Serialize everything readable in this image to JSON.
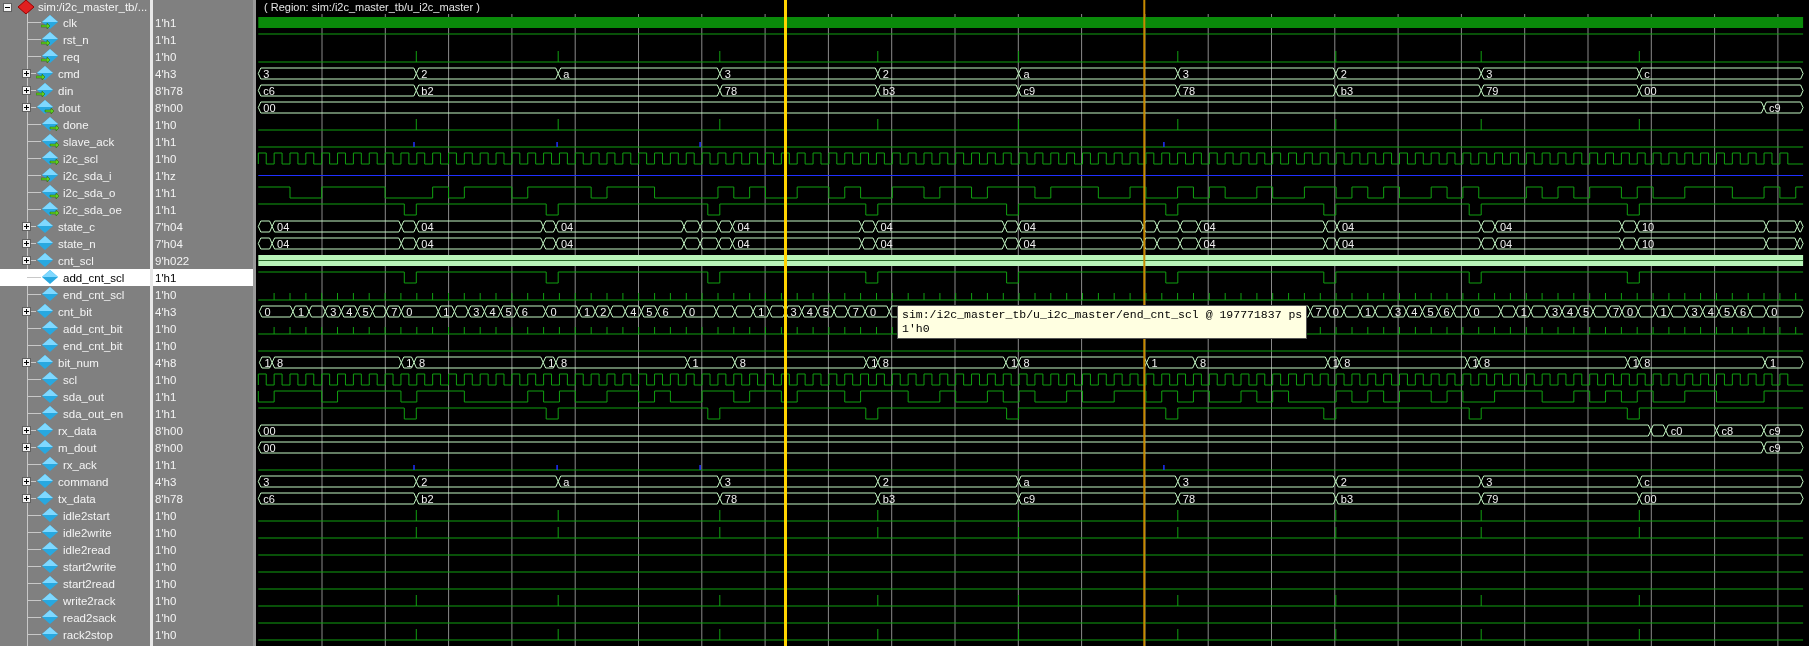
{
  "instance": {
    "label": "sim:/i2c_master_tb/...",
    "expanded": true
  },
  "region": "( Region: sim:/i2c_master_tb/u_i2c_master )",
  "signals": [
    {
      "name": "clk",
      "value": "1'h1",
      "input": true,
      "output": false,
      "expandable": false,
      "selected": false,
      "kind": "clock_bar"
    },
    {
      "name": "rst_n",
      "value": "1'h1",
      "input": true,
      "output": false,
      "expandable": false,
      "selected": false,
      "kind": "high"
    },
    {
      "name": "req",
      "value": "1'h0",
      "input": true,
      "output": false,
      "expandable": false,
      "selected": false,
      "kind": "pulse"
    },
    {
      "name": "cmd",
      "value": "4'h3",
      "input": true,
      "output": false,
      "expandable": true,
      "selected": false,
      "kind": "bus",
      "values": [
        "3",
        "2",
        "a",
        "3",
        "2",
        "a",
        "3",
        "2",
        "3",
        "c"
      ]
    },
    {
      "name": "din",
      "value": "8'h78",
      "input": true,
      "output": false,
      "expandable": true,
      "selected": false,
      "kind": "bus",
      "values": [
        "c6",
        "b2",
        "78",
        "b3",
        "c9",
        "78",
        "b3",
        "79",
        "00"
      ]
    },
    {
      "name": "dout",
      "value": "8'h00",
      "input": false,
      "output": true,
      "expandable": true,
      "selected": false,
      "kind": "bus",
      "values": [
        "00",
        "c9"
      ]
    },
    {
      "name": "done",
      "value": "1'h0",
      "input": false,
      "output": true,
      "expandable": false,
      "selected": false,
      "kind": "pulse"
    },
    {
      "name": "slave_ack",
      "value": "1'h1",
      "input": false,
      "output": true,
      "expandable": false,
      "selected": false,
      "kind": "ack"
    },
    {
      "name": "i2c_scl",
      "value": "1'h0",
      "input": false,
      "output": true,
      "expandable": false,
      "selected": false,
      "kind": "square"
    },
    {
      "name": "i2c_sda_i",
      "value": "1'hz",
      "input": true,
      "output": false,
      "expandable": false,
      "selected": false,
      "kind": "z"
    },
    {
      "name": "i2c_sda_o",
      "value": "1'h1",
      "input": false,
      "output": true,
      "expandable": false,
      "selected": false,
      "kind": "data"
    },
    {
      "name": "i2c_sda_oe",
      "value": "1'h1",
      "input": false,
      "output": true,
      "expandable": false,
      "selected": false,
      "kind": "enable"
    },
    {
      "name": "state_c",
      "value": "7'h04",
      "input": false,
      "output": false,
      "expandable": true,
      "selected": false,
      "kind": "bus",
      "values": [
        "04",
        "04",
        "04",
        "04",
        "04",
        "04",
        "04",
        "04",
        "04",
        "10"
      ]
    },
    {
      "name": "state_n",
      "value": "7'h04",
      "input": false,
      "output": false,
      "expandable": true,
      "selected": false,
      "kind": "bus",
      "values": [
        "04",
        "04",
        "04",
        "04",
        "04",
        "04",
        "04",
        "04",
        "04",
        "10"
      ]
    },
    {
      "name": "cnt_scl",
      "value": "9'h022",
      "input": false,
      "output": false,
      "expandable": true,
      "selected": false,
      "kind": "filled_bus"
    },
    {
      "name": "add_cnt_scl",
      "value": "1'h1",
      "input": false,
      "output": false,
      "expandable": false,
      "selected": true,
      "kind": "enable"
    },
    {
      "name": "end_cnt_scl",
      "value": "1'h0",
      "input": false,
      "output": false,
      "expandable": false,
      "selected": false,
      "kind": "spike"
    },
    {
      "name": "cnt_bit",
      "value": "4'h3",
      "input": false,
      "output": false,
      "expandable": true,
      "selected": false,
      "kind": "bus",
      "values": [
        "0",
        "1",
        "3",
        "4",
        "5",
        "7",
        "0",
        "1",
        "3",
        "4",
        "5",
        "6",
        "0",
        "1",
        "2",
        "4",
        "5",
        "6",
        "0",
        "1",
        "3",
        "4",
        "5",
        "7",
        "0",
        "7",
        "0",
        "1",
        "3",
        "4",
        "5",
        "6",
        "0",
        "1",
        "3",
        "4",
        "5",
        "7",
        "0",
        "1",
        "3",
        "4",
        "5",
        "6",
        "0"
      ]
    },
    {
      "name": "add_cnt_bit",
      "value": "1'h0",
      "input": false,
      "output": false,
      "expandable": false,
      "selected": false,
      "kind": "spike"
    },
    {
      "name": "end_cnt_bit",
      "value": "1'h0",
      "input": false,
      "output": false,
      "expandable": false,
      "selected": false,
      "kind": "low"
    },
    {
      "name": "bit_num",
      "value": "4'h8",
      "input": false,
      "output": false,
      "expandable": true,
      "selected": false,
      "kind": "bus",
      "values": [
        "1",
        "8",
        "1",
        "8",
        "1",
        "8",
        "1",
        "8",
        "1",
        "8",
        "1",
        "8",
        "1",
        "8",
        "1",
        "8",
        "1",
        "8",
        "1",
        "8",
        "1"
      ]
    },
    {
      "name": "scl",
      "value": "1'h0",
      "input": false,
      "output": false,
      "expandable": false,
      "selected": false,
      "kind": "square"
    },
    {
      "name": "sda_out",
      "value": "1'h1",
      "input": false,
      "output": false,
      "expandable": false,
      "selected": false,
      "kind": "data"
    },
    {
      "name": "sda_out_en",
      "value": "1'h1",
      "input": false,
      "output": false,
      "expandable": false,
      "selected": false,
      "kind": "enable"
    },
    {
      "name": "rx_data",
      "value": "8'h00",
      "input": false,
      "output": false,
      "expandable": true,
      "selected": false,
      "kind": "bus",
      "values": [
        "00",
        "c0",
        "c8",
        "c9"
      ]
    },
    {
      "name": "m_dout",
      "value": "8'h00",
      "input": false,
      "output": false,
      "expandable": true,
      "selected": false,
      "kind": "bus",
      "values": [
        "00",
        "c9"
      ]
    },
    {
      "name": "rx_ack",
      "value": "1'h1",
      "input": false,
      "output": false,
      "expandable": false,
      "selected": false,
      "kind": "ack"
    },
    {
      "name": "command",
      "value": "4'h3",
      "input": false,
      "output": false,
      "expandable": true,
      "selected": false,
      "kind": "bus",
      "values": [
        "3",
        "2",
        "a",
        "3",
        "2",
        "a",
        "3",
        "2",
        "3",
        "c"
      ]
    },
    {
      "name": "tx_data",
      "value": "8'h78",
      "input": false,
      "output": false,
      "expandable": true,
      "selected": false,
      "kind": "bus",
      "values": [
        "c6",
        "b2",
        "78",
        "b3",
        "c9",
        "78",
        "b3",
        "79",
        "00"
      ]
    },
    {
      "name": "idle2start",
      "value": "1'h0",
      "input": false,
      "output": false,
      "expandable": false,
      "selected": false,
      "kind": "pulse"
    },
    {
      "name": "idle2write",
      "value": "1'h0",
      "input": false,
      "output": false,
      "expandable": false,
      "selected": false,
      "kind": "pulse"
    },
    {
      "name": "idle2read",
      "value": "1'h0",
      "input": false,
      "output": false,
      "expandable": false,
      "selected": false,
      "kind": "low"
    },
    {
      "name": "start2write",
      "value": "1'h0",
      "input": false,
      "output": false,
      "expandable": false,
      "selected": false,
      "kind": "low"
    },
    {
      "name": "start2read",
      "value": "1'h0",
      "input": false,
      "output": false,
      "expandable": false,
      "selected": false,
      "kind": "low"
    },
    {
      "name": "write2rack",
      "value": "1'h0",
      "input": false,
      "output": false,
      "expandable": false,
      "selected": false,
      "kind": "pulse"
    },
    {
      "name": "read2sack",
      "value": "1'h0",
      "input": false,
      "output": false,
      "expandable": false,
      "selected": false,
      "kind": "low"
    },
    {
      "name": "rack2stop",
      "value": "1'h0",
      "input": false,
      "output": false,
      "expandable": false,
      "selected": false,
      "kind": "pulse"
    }
  ],
  "cursors": [
    {
      "selected": true
    },
    {
      "selected": false
    }
  ],
  "tooltip": {
    "path": "sim:/i2c_master_tb/u_i2c_master/end_cnt_scl @ 197771837 ps",
    "value": "1'h0"
  }
}
